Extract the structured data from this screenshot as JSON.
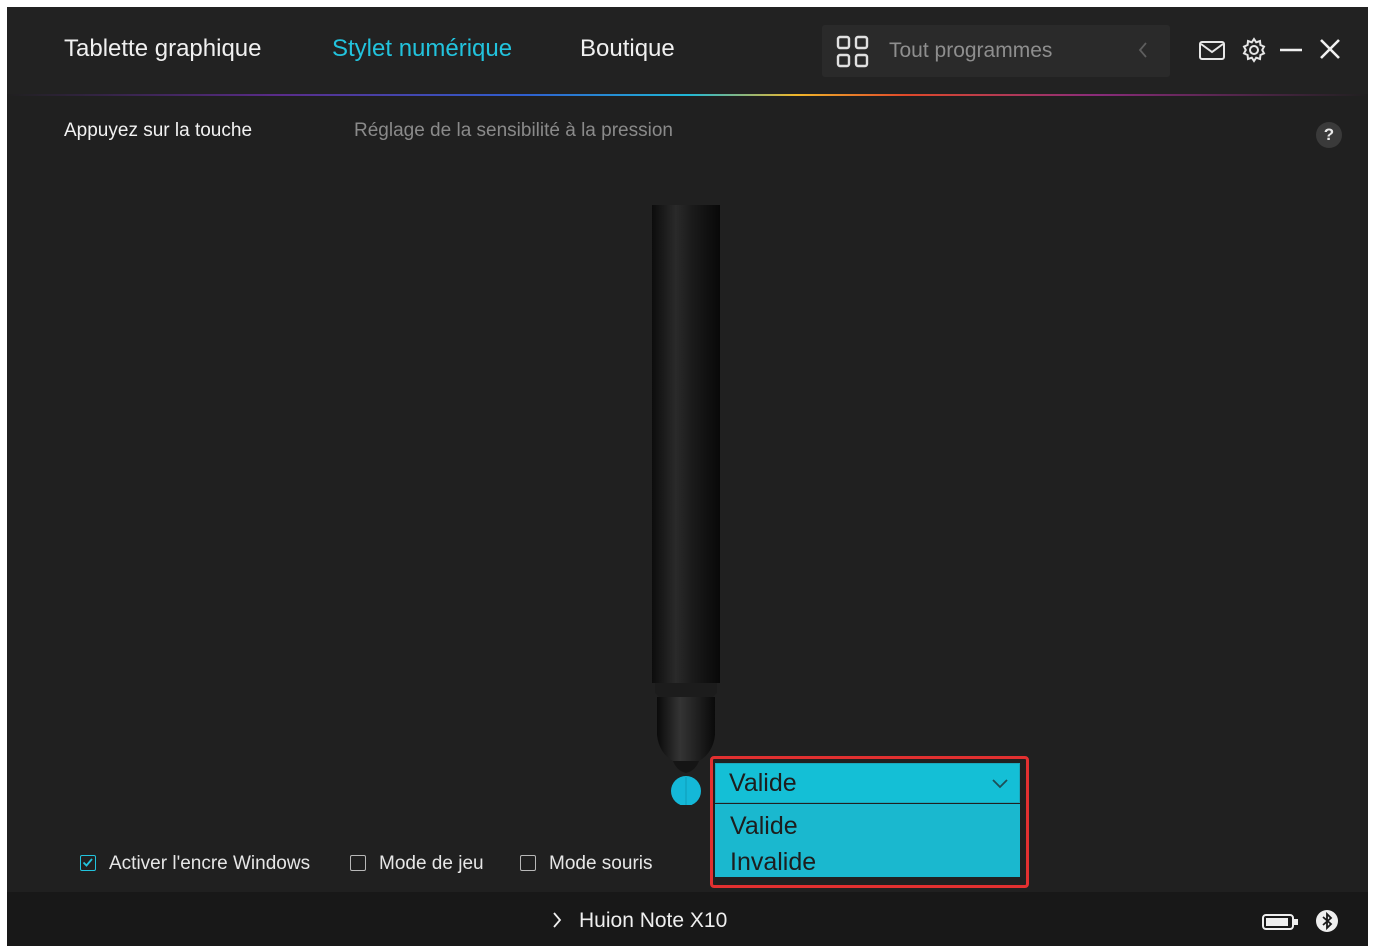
{
  "header": {
    "tabs": [
      {
        "label": "Tablette graphique",
        "active": false
      },
      {
        "label": "Stylet numérique",
        "active": true
      },
      {
        "label": "Boutique",
        "active": false
      }
    ],
    "search": {
      "placeholder": "Tout programmes",
      "apps_icon": "apps-grid-icon",
      "back_icon": "chevron-left-icon"
    },
    "window_icons": [
      "mail-icon",
      "gear-icon",
      "minimize-icon",
      "close-icon"
    ]
  },
  "subtabs": [
    {
      "label": "Appuyez sur la touche",
      "active": true
    },
    {
      "label": "Réglage de la sensibilité à la pression",
      "active": false
    }
  ],
  "help": {
    "label": "?"
  },
  "pen_dropdown": {
    "selected": "Valide",
    "options": [
      "Valide",
      "Invalide"
    ],
    "highlight_color": "#e23030"
  },
  "checkboxes": [
    {
      "label": "Activer l'encre Windows",
      "checked": true
    },
    {
      "label": "Mode de jeu",
      "checked": false
    },
    {
      "label": "Mode souris",
      "checked": false
    }
  ],
  "footer": {
    "device_name": "Huion Note X10",
    "expand_icon": "chevron-right-icon",
    "battery_icon": "battery-icon",
    "bluetooth_icon": "bluetooth-icon"
  },
  "colors": {
    "accent": "#22c3dd",
    "background": "#202020",
    "dropdown": "#14bfd6"
  }
}
